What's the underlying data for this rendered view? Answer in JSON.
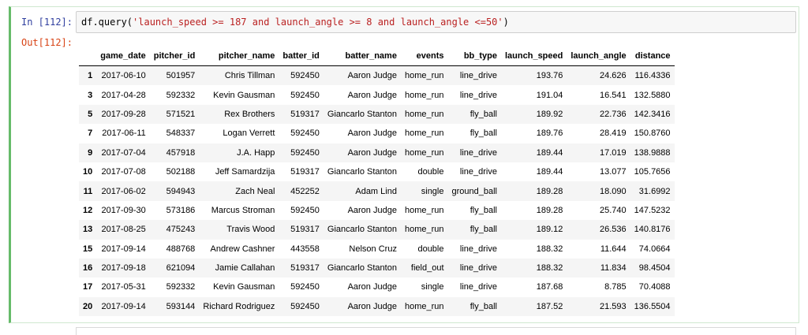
{
  "cell": {
    "in_prompt": "In [112]:",
    "out_prompt": "Out[112]:",
    "code_prefix": "df.query(",
    "code_string": "'launch_speed >= 187 and launch_angle >= 8 and launch_angle <=50'",
    "code_suffix": ")"
  },
  "table": {
    "columns": [
      "",
      "game_date",
      "pitcher_id",
      "pitcher_name",
      "batter_id",
      "batter_name",
      "events",
      "bb_type",
      "launch_speed",
      "launch_angle",
      "distance"
    ],
    "rows": [
      [
        "1",
        "2017-06-10",
        "501957",
        "Chris Tillman",
        "592450",
        "Aaron Judge",
        "home_run",
        "line_drive",
        "193.76",
        "24.626",
        "116.4336"
      ],
      [
        "3",
        "2017-04-28",
        "592332",
        "Kevin Gausman",
        "592450",
        "Aaron Judge",
        "home_run",
        "line_drive",
        "191.04",
        "16.541",
        "132.5880"
      ],
      [
        "5",
        "2017-09-28",
        "571521",
        "Rex Brothers",
        "519317",
        "Giancarlo Stanton",
        "home_run",
        "fly_ball",
        "189.92",
        "22.736",
        "142.3416"
      ],
      [
        "7",
        "2017-06-11",
        "548337",
        "Logan Verrett",
        "592450",
        "Aaron Judge",
        "home_run",
        "fly_ball",
        "189.76",
        "28.419",
        "150.8760"
      ],
      [
        "9",
        "2017-07-04",
        "457918",
        "J.A. Happ",
        "592450",
        "Aaron Judge",
        "home_run",
        "line_drive",
        "189.44",
        "17.019",
        "138.9888"
      ],
      [
        "10",
        "2017-07-08",
        "502188",
        "Jeff Samardzija",
        "519317",
        "Giancarlo Stanton",
        "double",
        "line_drive",
        "189.44",
        "13.077",
        "105.7656"
      ],
      [
        "11",
        "2017-06-02",
        "594943",
        "Zach Neal",
        "452252",
        "Adam Lind",
        "single",
        "ground_ball",
        "189.28",
        "18.090",
        "31.6992"
      ],
      [
        "12",
        "2017-09-30",
        "573186",
        "Marcus Stroman",
        "592450",
        "Aaron Judge",
        "home_run",
        "fly_ball",
        "189.28",
        "25.740",
        "147.5232"
      ],
      [
        "13",
        "2017-08-25",
        "475243",
        "Travis Wood",
        "519317",
        "Giancarlo Stanton",
        "home_run",
        "fly_ball",
        "189.12",
        "26.536",
        "140.8176"
      ],
      [
        "15",
        "2017-09-14",
        "488768",
        "Andrew Cashner",
        "443558",
        "Nelson Cruz",
        "double",
        "line_drive",
        "188.32",
        "11.644",
        "74.0664"
      ],
      [
        "16",
        "2017-09-18",
        "621094",
        "Jamie Callahan",
        "519317",
        "Giancarlo Stanton",
        "field_out",
        "line_drive",
        "188.32",
        "11.834",
        "98.4504"
      ],
      [
        "17",
        "2017-05-31",
        "592332",
        "Kevin Gausman",
        "592450",
        "Aaron Judge",
        "single",
        "line_drive",
        "187.68",
        "8.785",
        "70.4088"
      ],
      [
        "20",
        "2017-09-14",
        "593144",
        "Richard Rodriguez",
        "592450",
        "Aaron Judge",
        "home_run",
        "fly_ball",
        "187.52",
        "21.593",
        "136.5504"
      ]
    ]
  }
}
